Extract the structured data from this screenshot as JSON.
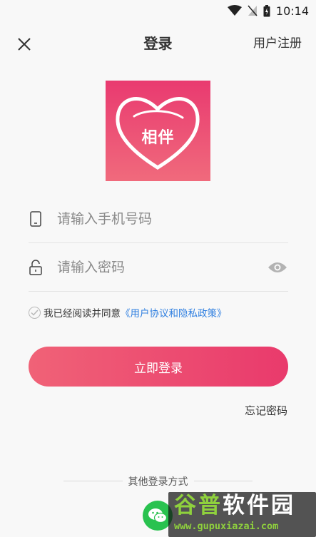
{
  "status_bar": {
    "time": "10:14"
  },
  "header": {
    "title": "登录",
    "register_label": "用户注册"
  },
  "logo": {
    "text": "相伴"
  },
  "phone_field": {
    "placeholder": "请输入手机号码"
  },
  "password_field": {
    "placeholder": "请输入密码"
  },
  "agreement": {
    "text": "我已经阅读并同意",
    "link": "《用户协议和隐私政策》"
  },
  "login_button": {
    "label": "立即登录"
  },
  "forgot_password": {
    "label": "忘记密码"
  },
  "other_login": {
    "label": "其他登录方式"
  },
  "watermark": {
    "title_part1": "谷普",
    "title_part2": "软件园",
    "url": "www.gupuxiazai.com"
  },
  "colors": {
    "brand_pink": "#e93a6c",
    "link_blue": "#2f7fe0",
    "wechat_green": "#29c24f"
  }
}
